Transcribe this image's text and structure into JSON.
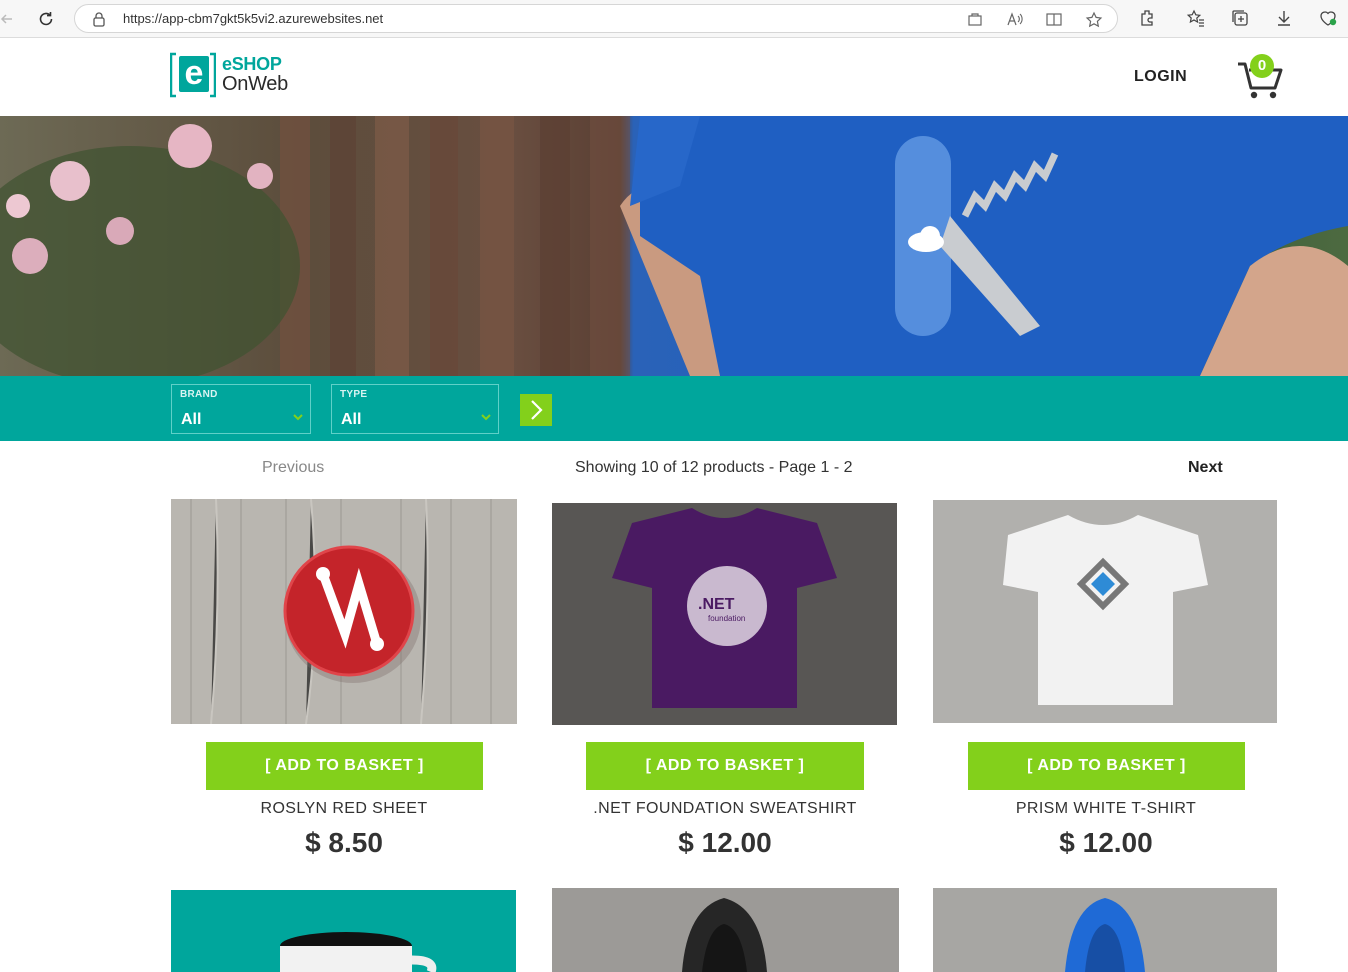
{
  "browser": {
    "url": "https://app-cbm7gkt5k5vi2.azurewebsites.net"
  },
  "header": {
    "logo_line1": "eSHOP",
    "logo_line2": "OnWeb",
    "logo_mark": "e",
    "login_label": "LOGIN",
    "cart_count": "0"
  },
  "filters": {
    "brand_label": "BRAND",
    "brand_value": "All",
    "type_label": "TYPE",
    "type_value": "All"
  },
  "pager": {
    "previous": "Previous",
    "info": "Showing 10 of 12 products - Page 1 - 2",
    "next": "Next"
  },
  "products": [
    {
      "name": "ROSLYN RED SHEET",
      "price": "$ 8.50",
      "button": "[ ADD TO BASKET ]"
    },
    {
      "name": ".NET FOUNDATION SWEATSHIRT",
      "price": "$ 12.00",
      "button": "[ ADD TO BASKET ]"
    },
    {
      "name": "PRISM WHITE T-SHIRT",
      "price": "$ 12.00",
      "button": "[ ADD TO BASKET ]"
    }
  ],
  "product_row2": [
    "mug",
    "black hoodie",
    "blue hoodie"
  ],
  "colors": {
    "teal": "#00a69c",
    "green": "#83d01b",
    "text": "#333333"
  },
  "tshirt_logo_text": ".NET",
  "tshirt_logo_sub": "foundation"
}
